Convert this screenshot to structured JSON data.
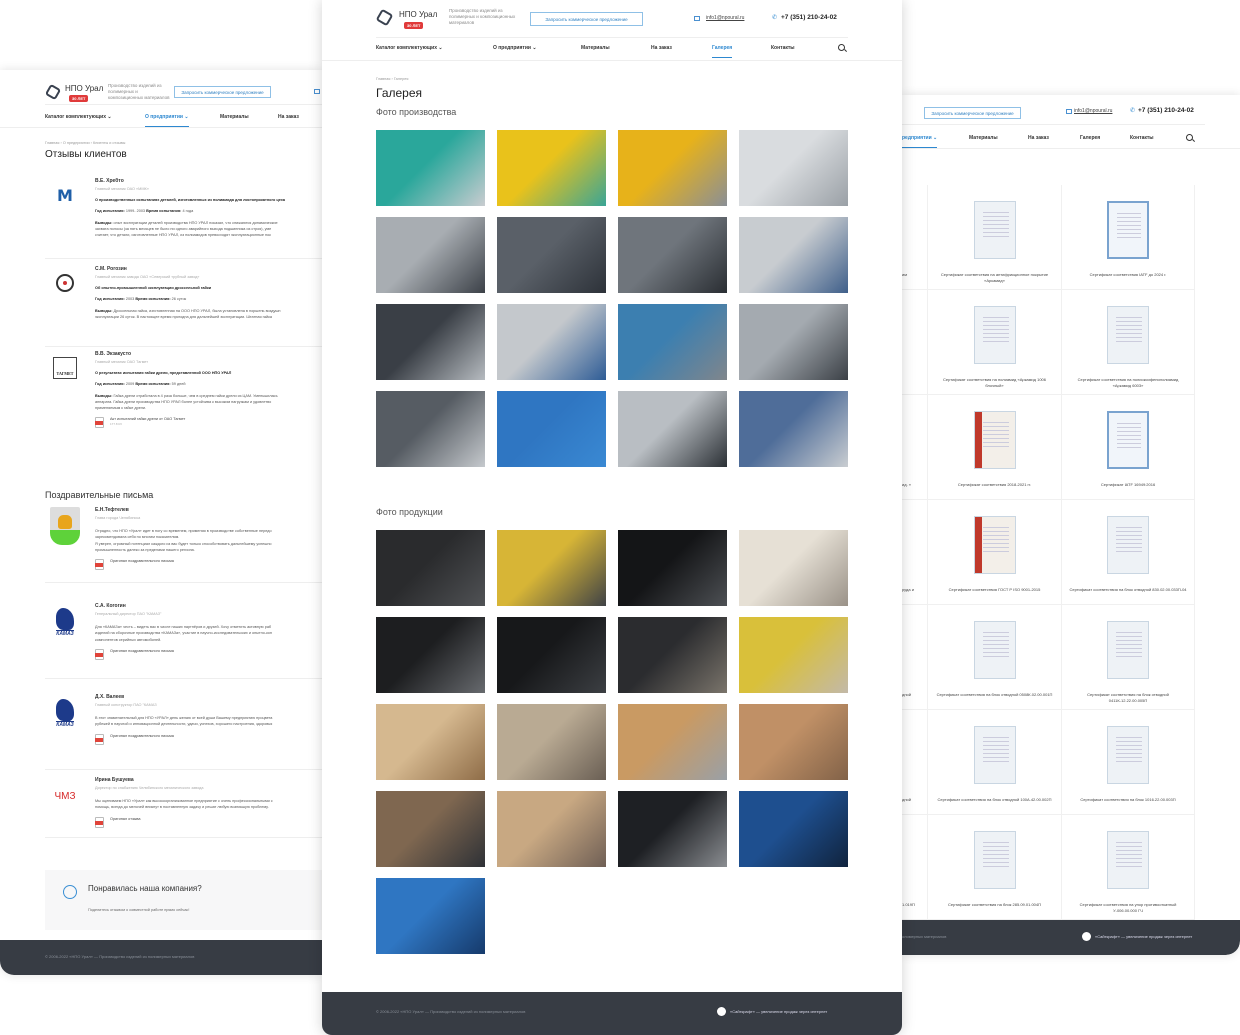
{
  "brand": {
    "name": "НПО Урал",
    "badge": "30 ЛЕТ",
    "tagline": "Производство изделий из полимерных и композиционных материалов"
  },
  "header": {
    "request_button": "Запросить коммерческое предложение",
    "email": "info1@npoural.ru",
    "phone": "+7 (351) 210-24-02"
  },
  "nav": {
    "items": [
      {
        "label": "Каталог комплектующих ⌄"
      },
      {
        "label": "О предприятии ⌄"
      },
      {
        "label": "Материалы"
      },
      {
        "label": "На заказ"
      },
      {
        "label": "Галерея"
      },
      {
        "label": "Контакты"
      }
    ]
  },
  "accent": "#2d88d0",
  "left_page": {
    "breadcrumb": "Главная  ›  О предприятии  ›  Клиенты и отзывы",
    "title": "Отзывы клиентов",
    "reviews": [
      {
        "name": "В.Е. Хребто",
        "position": "Главный механик ОАО «ММК»",
        "subject": "О производственных испытаниях деталей, изготовленных из полиамида для листопрокатного цеха",
        "year_label": "Год испытания:",
        "year": "1999- 2003",
        "time_label": "Время испытания:",
        "time": "4 года",
        "conclusion_label": "Выводы:",
        "conclusion": [
          "опыт эксплуатации деталей производства НПО УРАЛ показал, что снижаются динамические",
          "захвата полосы (за пять месяцев не было ни одного аварийного выхода подшипника из строя), уме",
          "считает, что детали, изготовленные НПО УРАЛ, из полиамидов превосходят эксплуатационные пок"
        ],
        "logo": "mmk-logo"
      },
      {
        "name": "С.М. Рогозин",
        "position": "Главный механик завода ОАО «Северский трубный завод»",
        "subject": "Об опытно-промышленной эксплуатации дроссельной гайки",
        "year_label": "Год испытания:",
        "year": "2003",
        "time_label": "Время испытания:",
        "time": "26 суток",
        "conclusion_label": "Выводы:",
        "conclusion": [
          "Дроссельная гайка, изготовленная на ООО НПО УРАЛ, была установлена в поршень воздушн",
          "эксплуатации 26 суток. В настоящее время пригодна для дальнейшей эксплуатации. Штатная гайка"
        ],
        "logo": "stz-logo"
      },
      {
        "name": "В.В. Экзакусто",
        "position": "Главный механик ОАО Тагмет",
        "subject": "О результатах испытания гайки дрели, представленной ООО НПО УРАЛ",
        "year_label": "Год испытания:",
        "year": "2009",
        "time_label": "Время испытания:",
        "time": "59 дней",
        "conclusion_label": "Выводы:",
        "conclusion": [
          "Гайка дрели отработала в 4 раза больше, чем в среднем гайки дрели из ЦАМ. Уменьшилась",
          "аппарата. Гайка дрели производства НПО УРАЛ более устойчива к высоким нагрузкам и удовлетво",
          "применяемым к гайке дрели."
        ],
        "logo": "tagmet-logo",
        "logo_text": "ТАГМЕТ",
        "doc": {
          "title": "Акт испытаний гайки дрели от ОАО Тагмет",
          "size": "177.8 Кб"
        }
      }
    ],
    "letters_title": "Поздравительные письма",
    "letters": [
      {
        "name": "Е.Н.Тефтелев",
        "position": "Глава города Челябинска",
        "text": [
          "Отрадно, что НПО «Урал» идет в ногу со временем, применяя в производстве собственные передо",
          "зарекомендовала себя по многим показателям.",
          "Я уверен, огромный потенциал каждого из вас будет только способствовать дальнейшему успешно",
          "промышленность далеко за пределами нашего региона."
        ],
        "doc": "Оригинал поздравительного письма",
        "logo": "chelyabinsk-coat-of-arms"
      },
      {
        "name": "С.А. Когогин",
        "position": "Генеральный директор ПАО \"КАМАЗ\"",
        "text": [
          "Для «КАМАЗа» честь – видеть вас в числе наших партнёров и друзей. Хочу отметить активную раб",
          "изделий на сборочные производства «КАМАЗа», участие в научно-исследовательских и опытно-кон",
          "компонентов серийных автомобилей."
        ],
        "doc": "Оригинал поздравительного письма",
        "logo": "kamaz-logo",
        "logo_text": "КАМАЗ"
      },
      {
        "name": "Д.Х. Валеев",
        "position": "Главный конструктор ПАО \"КАМАЗ",
        "text": [
          "В этот знаменательный для НПО «УРАЛ» день желаю от всей души Вашему предприятию процвета",
          "рубежей в научной и инновационной деятельности, удачи, успехов, хорошего настроения, здоровья"
        ],
        "doc": "Оригинал поздравительного письма",
        "logo": "kamaz-logo",
        "logo_text": "КАМАЗ"
      },
      {
        "name": "Ирина Бушуева",
        "position": "Директор по снабжению Челябинского механического завода",
        "text": [
          "Мы оцениваем НПО «Урал» как высокоорганизованное предприятие с очень профессиональными с",
          "помощь, всегда до мелочей вникнут в поставленную задачу и решат любую возникшую проблему."
        ],
        "doc": "Оригинал отзыва",
        "logo": "chmz-logo",
        "logo_text": "ЧМЗ"
      }
    ],
    "callout": {
      "title": "Понравилась наша компания?",
      "text": "Поделитесь отзывом о совместной работе прямо сейчас!"
    },
    "footer": "© 2006-2022 «НПО Урал» — Производство изделий из полимерных материалов"
  },
  "center_page": {
    "breadcrumb": "Главная  ›  Галерея",
    "title": "Галерея",
    "production_title": "Фото производства",
    "production_photos": [
      [
        "#2aa79b",
        "#c9ccd0"
      ],
      [
        "#e9c21b",
        "#3aa596"
      ],
      [
        "#e7b21a",
        "#8a8f96"
      ],
      [
        "#d9dcdf",
        "#9aa0a6"
      ],
      [
        "#a8adb2",
        "#3c4148"
      ],
      [
        "#5a6068",
        "#2d3239"
      ],
      [
        "#6f757c",
        "#2a2e33"
      ],
      [
        "#c8ccd0",
        "#3f5f8a"
      ],
      [
        "#3a3f46",
        "#b6bbc0"
      ],
      [
        "#c4c8cc",
        "#2e5c96"
      ],
      [
        "#3c7fb0",
        "#80868c"
      ],
      [
        "#a4aab0",
        "#3b4046"
      ],
      [
        "#565c63",
        "#c5c9cd"
      ],
      [
        "#2f76c2",
        "#3a89d3"
      ],
      [
        "#b9bec3",
        "#2b3035"
      ],
      [
        "#4f6d99",
        "#c9cdd1"
      ]
    ],
    "products_title": "Фото продукции",
    "product_photos": [
      [
        "#2a2b2d",
        "#505255"
      ],
      [
        "#d7b536",
        "#3f4246"
      ],
      [
        "#141517",
        "#4d5054"
      ],
      [
        "#e6e0d5",
        "#9a9288"
      ],
      [
        "#1d1e20",
        "#676a6e"
      ],
      [
        "#17181a",
        "#3c3f43"
      ],
      [
        "#2b2c2f",
        "#7a746b"
      ],
      [
        "#d9c03a",
        "#c3b9a8"
      ],
      [
        "#d5b88f",
        "#8f6d48"
      ],
      [
        "#b9aa93",
        "#6a5f54"
      ],
      [
        "#c99a63",
        "#9aa0a6"
      ],
      [
        "#c09066",
        "#826248"
      ],
      [
        "#7f6750",
        "#2e3136"
      ],
      [
        "#c8a882",
        "#6f5f55"
      ],
      [
        "#1e2024",
        "#8a8d91"
      ],
      [
        "#1e4f8f",
        "#10233d"
      ],
      [
        "#2f76c2",
        "#163a6b"
      ]
    ],
    "footer": "© 2006-2022 «НПО Урал» — Производство изделий из полимерных материалов",
    "footer_right": "«Сайткрафт» — увеличение продаж через интернет"
  },
  "right_page": {
    "nav_partial": "редприятии ⌄",
    "certificates": [
      {
        "frag": "им",
        "left": "Сертификат соответствия на антифрикционное покрытие «Аркамид»",
        "right": "Сертификат соответствия IATF до 2024 г.",
        "lt": "plain",
        "rt": "blue"
      },
      {
        "frag": "",
        "left": "Сертификат соответствия на полиамид «Аркамид 1006 блочный»",
        "right": "Сертификат соответствия на полиоксифенилолиамид «Аркамид 6003»",
        "lt": "plain",
        "rt": "plain"
      },
      {
        "frag": "ид. »",
        "left": "Сертификат соответствия 2018-2021 гг.",
        "right": "Сертификат IATF 16949:2016",
        "lt": "red",
        "rt": "blue"
      },
      {
        "frag": "руда и",
        "left": "Сертификат соответствия ГОСТ Р ISO 9001-2015",
        "right": "Сертификат соответствия на блок отводной 830.02.00.033П-04",
        "lt": "red",
        "rt": "plain"
      },
      {
        "frag": "дной",
        "left": "Сертификат соответствия на блок отводной 0508К.02.00.001П",
        "right": "Сертификат соответствия на блок отводной 0411К-12.22.00.005П",
        "lt": "plain",
        "rt": "plain"
      },
      {
        "frag": "дной",
        "left": "Сертификат соответствия на блок отводной 100А.42.00.002П",
        "right": "Сертификат соответствия на блок 1016.22.00.003П",
        "lt": "plain",
        "rt": "plain"
      },
      {
        "frag": "1.019П",
        "left": "Сертификат соответствия на блок 285.09.01.004П",
        "right": "Сертификат соответствия на упор противооткатный У-006.00.000 ГЧ",
        "lt": "plain",
        "rt": "plain"
      }
    ],
    "footer_left": "олимерных материалов",
    "footer_right": "«Сайткрафт» — увеличение продаж через интернет"
  }
}
